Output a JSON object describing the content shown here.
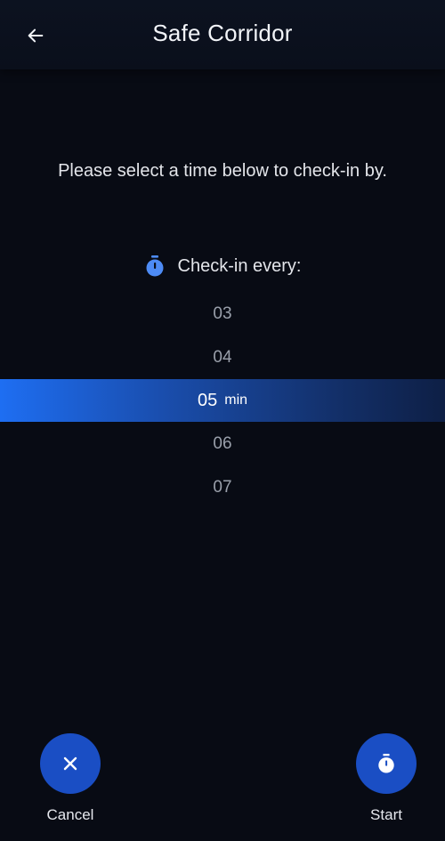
{
  "header": {
    "title": "Safe Corridor",
    "back_icon": "arrow-left-icon"
  },
  "instruction": "Please select a time below to check-in by.",
  "checkin": {
    "label": "Check-in every:",
    "icon": "stopwatch-icon",
    "icon_color": "#4d8bf5"
  },
  "picker": {
    "items": [
      "03",
      "04",
      "05",
      "06",
      "07"
    ],
    "selected_value": "05",
    "unit": "min"
  },
  "actions": {
    "cancel": {
      "label": "Cancel",
      "icon": "close-icon"
    },
    "start": {
      "label": "Start",
      "icon": "stopwatch-icon"
    }
  },
  "colors": {
    "background": "#080b14",
    "accent": "#1a4ec4",
    "highlight": "#1e6ef2"
  }
}
